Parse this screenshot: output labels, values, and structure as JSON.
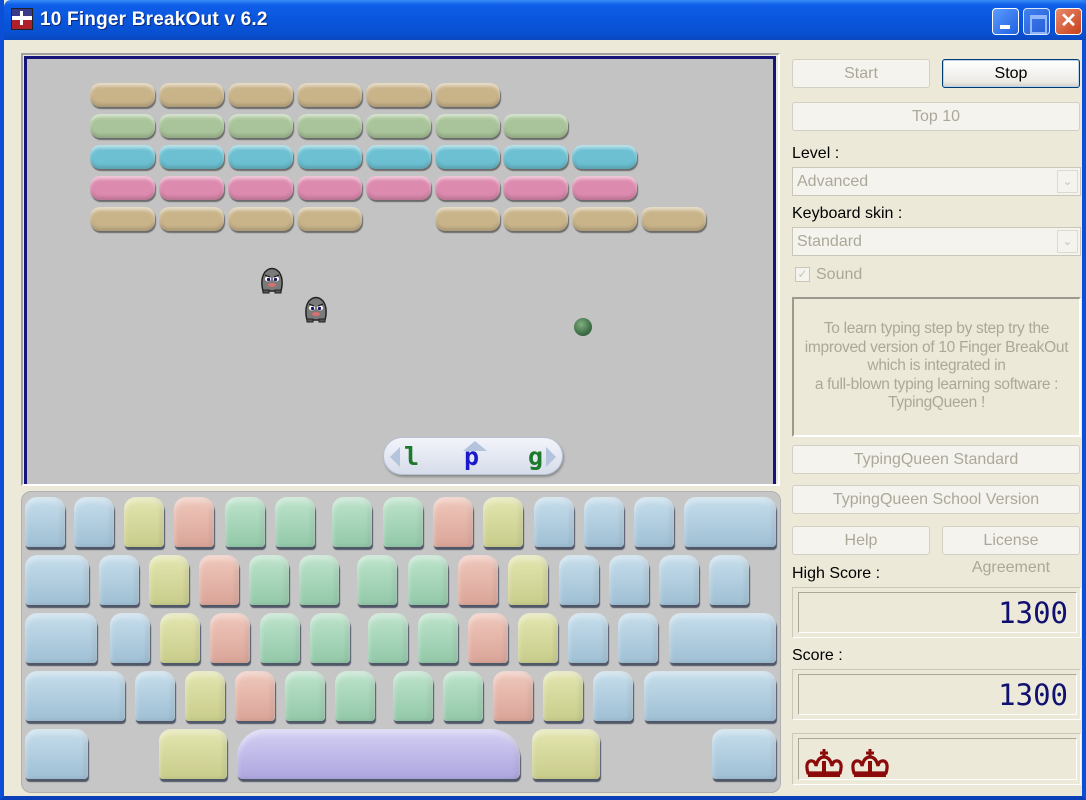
{
  "window": {
    "title": "10 Finger BreakOut v 6.2",
    "controls": {
      "minimize": "minimize",
      "maximize": "maximize",
      "close": "✕"
    }
  },
  "game": {
    "brick_colors": {
      "tan": "#C9B48A",
      "green": "#A9C49A",
      "cyan": "#6CC0D2",
      "pink": "#DC8AAE"
    },
    "brick_rows": [
      {
        "color": "tan",
        "columns": [
          0,
          1,
          2,
          3,
          4,
          5
        ]
      },
      {
        "color": "green",
        "columns": [
          0,
          1,
          2,
          3,
          4,
          5,
          6
        ]
      },
      {
        "color": "cyan",
        "columns": [
          0,
          1,
          2,
          3,
          4,
          5,
          6,
          7
        ]
      },
      {
        "color": "pink",
        "columns": [
          0,
          1,
          2,
          3,
          4,
          5,
          6,
          7
        ]
      },
      {
        "color": "tan",
        "columns": [
          0,
          1,
          2,
          3,
          5,
          6,
          7,
          8
        ]
      }
    ],
    "enemies": 2,
    "paddle": {
      "letters": [
        {
          "char": "l",
          "color": "#1E7A2A"
        },
        {
          "char": "p",
          "color": "#1A1ACA"
        },
        {
          "char": "g",
          "color": "#1E7A2A"
        }
      ]
    }
  },
  "keyboard": {
    "rows": [
      [
        "blue",
        "blue",
        "yellow",
        "pink",
        "green",
        "green",
        "green",
        "green",
        "pink",
        "yellow",
        "blue",
        "blue",
        "blue",
        "blue"
      ],
      [
        "blue",
        "blue",
        "yellow",
        "pink",
        "green",
        "green",
        "green",
        "green",
        "pink",
        "yellow",
        "blue",
        "blue",
        "blue",
        "blue"
      ],
      [
        "blue",
        "blue",
        "yellow",
        "pink",
        "green",
        "green",
        "green",
        "green",
        "pink",
        "yellow",
        "blue",
        "blue",
        "blue"
      ],
      [
        "blue",
        "blue",
        "yellow",
        "pink",
        "green",
        "green",
        "green",
        "green",
        "pink",
        "yellow",
        "blue",
        "blue"
      ],
      [
        "blue",
        "yellow",
        "purple",
        "yellow",
        "blue"
      ]
    ]
  },
  "panel": {
    "start_label": "Start",
    "stop_label": "Stop",
    "top10_label": "Top 10",
    "level_label": "Level :",
    "level_value": "Advanced",
    "skin_label": "Keyboard skin :",
    "skin_value": "Standard",
    "sound_label": "Sound",
    "sound_checked": true,
    "info_lines": [
      "To learn typing step by step try the",
      "improved version of 10 Finger BreakOut",
      "which is integrated in",
      "a full-blown typing learning software :",
      "TypingQueen !"
    ],
    "tq_standard_label": "TypingQueen Standard",
    "tq_school_label": "TypingQueen School Version",
    "help_label": "Help",
    "license_label": "License Agreement",
    "high_score_label": "High Score :",
    "high_score": "1300",
    "score_label": "Score :",
    "score": "1300",
    "lives": 2,
    "lives_color": "#8B0A0A"
  }
}
